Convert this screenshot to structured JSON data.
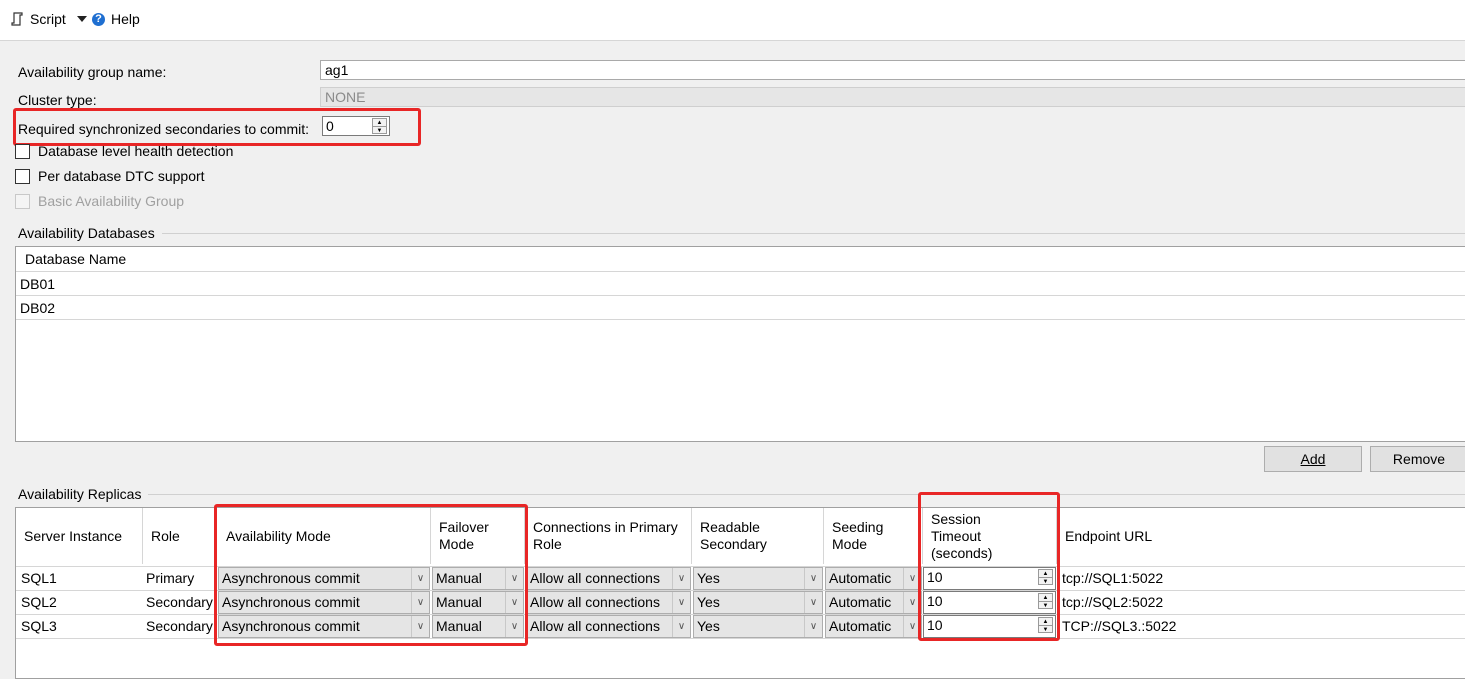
{
  "toolbar": {
    "script_label": "Script",
    "help_label": "Help"
  },
  "general": {
    "ag_name_label": "Availability group name:",
    "ag_name_value": "ag1",
    "cluster_type_label": "Cluster type:",
    "cluster_type_value": "NONE",
    "required_sync_label": "Required synchronized secondaries to commit:",
    "required_sync_value": "0",
    "db_health_label": "Database level health detection",
    "dtc_label": "Per database DTC support",
    "basic_ag_label": "Basic Availability Group"
  },
  "databases": {
    "section_label": "Availability Databases",
    "column_header": "Database Name",
    "rows": [
      "DB01",
      "DB02"
    ],
    "add_label": "Add",
    "remove_label": "Remove"
  },
  "replicas": {
    "section_label": "Availability Replicas",
    "headers": {
      "server": "Server Instance",
      "role": "Role",
      "availability_mode": "Availability Mode",
      "failover_mode": "Failover Mode",
      "connections": "Connections in Primary Role",
      "readable": "Readable Secondary",
      "seeding": "Seeding Mode",
      "session_timeout": "Session Timeout (seconds)",
      "endpoint": "Endpoint URL"
    },
    "rows": [
      {
        "server": "SQL1",
        "role": "Primary",
        "availability_mode": "Asynchronous commit",
        "failover_mode": "Manual",
        "connections": "Allow all connections",
        "readable": "Yes",
        "seeding": "Automatic",
        "session_timeout": "10",
        "endpoint": "tcp://SQL1:5022"
      },
      {
        "server": "SQL2",
        "role": "Secondary",
        "availability_mode": "Asynchronous commit",
        "failover_mode": "Manual",
        "connections": "Allow all connections",
        "readable": "Yes",
        "seeding": "Automatic",
        "session_timeout": "10",
        "endpoint": "tcp://SQL2:5022"
      },
      {
        "server": "SQL3",
        "role": "Secondary",
        "availability_mode": "Asynchronous commit",
        "failover_mode": "Manual",
        "connections": "Allow all connections",
        "readable": "Yes",
        "seeding": "Automatic",
        "session_timeout": "10",
        "endpoint": "TCP://SQL3.:5022"
      }
    ]
  },
  "colors": {
    "highlight": "#e82626",
    "help_icon": "#1f6fd1"
  }
}
